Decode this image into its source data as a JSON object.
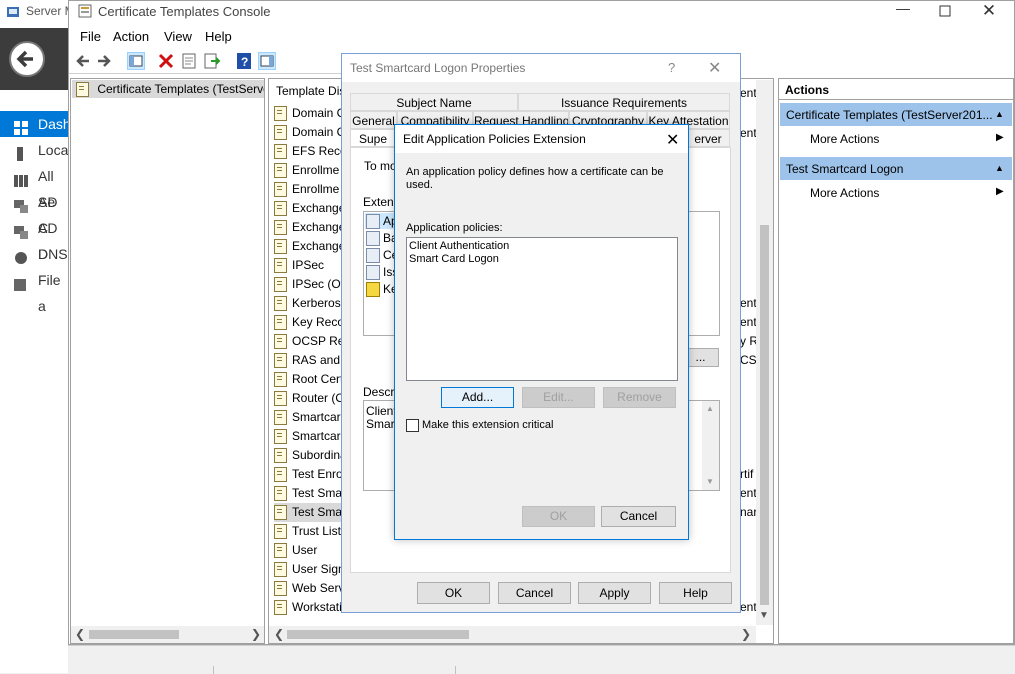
{
  "server_manager": {
    "title": "Server M",
    "nav": [
      "Dash",
      "Local",
      "All Se",
      "AD C",
      "AD D",
      "DNS",
      "File a"
    ]
  },
  "console": {
    "title": "Certificate Templates Console",
    "menu": [
      "File",
      "Action",
      "View",
      "Help"
    ],
    "tree_root": "Certificate Templates (TestServe",
    "list_header": "Template Dis",
    "templates": [
      "Domain C",
      "Domain C",
      "EFS Reco",
      "Enrollme",
      "Enrollme",
      "Exchange",
      "Exchange",
      "Exchange",
      "IPSec",
      "IPSec (Of",
      "Kerberos",
      "Key Reco",
      "OCSP Res",
      "RAS and I",
      "Root Cert",
      "Router (O",
      "Smartcard",
      "Smartcard",
      "Subordina",
      "Test Enrol",
      "Test Smar",
      "Test Smar",
      "Trust List",
      "User",
      "User Sign",
      "Web Serv",
      "Workstation Authentication"
    ],
    "right_col_fragments": [
      "ent",
      "ent",
      "ent",
      "y R",
      "CSP",
      "ent",
      "rtif",
      "ent",
      "nart",
      "ent"
    ],
    "actions": {
      "header": "Actions",
      "section1": "Certificate Templates (TestServer201...",
      "section1_more": "More Actions",
      "section2": "Test Smartcard Logon",
      "section2_more": "More Actions"
    }
  },
  "properties_dialog": {
    "title": "Test Smartcard Logon Properties",
    "help_glyph": "?",
    "tabs_row1": [
      "Subject Name",
      "Issuance Requirements"
    ],
    "tabs_row2": [
      "General",
      "Compatibility",
      "Request Handling",
      "Cryptography",
      "Key Attestation"
    ],
    "tabs_row3": [
      "Supe",
      "erver"
    ],
    "to_modify": "To mo",
    "extensions_label": "Extens",
    "extension_items": [
      "Ap",
      "Ba",
      "Ce",
      "Iss",
      "Ke"
    ],
    "edit_button": "...",
    "description_label": "Descri",
    "description_lines": [
      "Client",
      "Smart"
    ],
    "buttons": {
      "ok": "OK",
      "cancel": "Cancel",
      "apply": "Apply",
      "help": "Help"
    }
  },
  "edit_dialog": {
    "title": "Edit Application Policies Extension",
    "description": "An application policy defines how a certificate can be used.",
    "policies_label": "Application policies:",
    "policies": [
      "Client Authentication",
      "Smart Card Logon"
    ],
    "add_button": "Add...",
    "edit_button": "Edit...",
    "remove_button": "Remove",
    "critical_label": "Make this extension critical",
    "critical_checked": false,
    "ok_button": "OK",
    "cancel_button": "Cancel"
  },
  "colors": {
    "selection": "#cce8ff",
    "actions_header_bg": "#9ec3ea",
    "accent_border": "#0078d7",
    "dashboard_selected": "#0078d7"
  }
}
